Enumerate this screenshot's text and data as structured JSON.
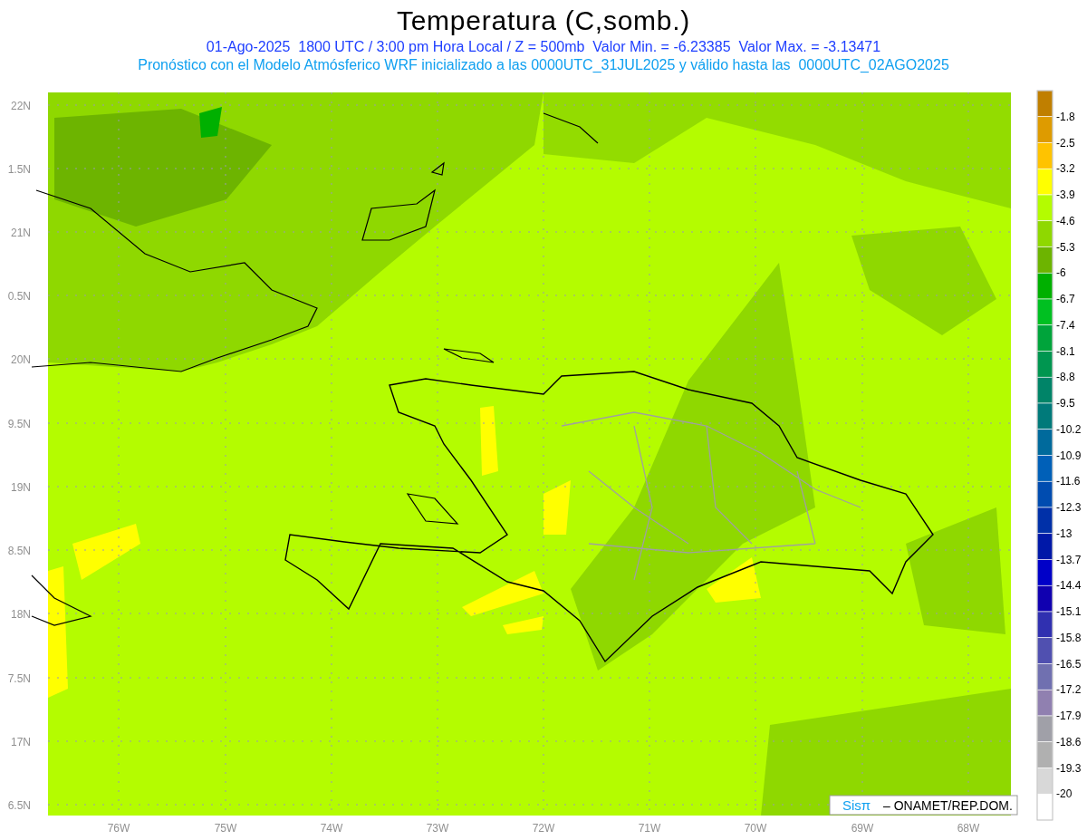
{
  "title": "Temperatura (C,somb.)",
  "subtitle_lines": [
    {
      "kind": "valid",
      "text": "01-Ago-2025  1800 UTC / 3:00 pm Hora Local / Z = 500mb  Valor Min. = -6.23385  Valor Max. = -3.13471"
    },
    {
      "kind": "model",
      "text": "Pronóstico con el Modelo Atmósferico WRF inicializado a las 0000UTC_31JUL2025 y válido hasta las  0000UTC_02AGO2025"
    }
  ],
  "map": {
    "y_axis_labels": [
      "22N",
      "1.5N",
      "21N",
      "0.5N",
      "20N",
      "9.5N",
      "19N",
      "8.5N",
      "18N",
      "7.5N",
      "17N",
      "6.5N"
    ],
    "x_axis_labels": [
      "76W",
      "75W",
      "74W",
      "73W",
      "72W",
      "71W",
      "70W",
      "69W",
      "68W"
    ]
  },
  "credit": {
    "logo": "Sisπ",
    "text": "– ONAMET/REP.DOM."
  },
  "colorbar": {
    "bins": [
      {
        "color": "#c07f00"
      },
      {
        "color": "#de9b00"
      },
      {
        "color": "#ffc300"
      },
      {
        "color": "#ffff00"
      },
      {
        "color": "#b4fc00"
      },
      {
        "color": "#8fd800"
      },
      {
        "color": "#6db400"
      },
      {
        "color": "#00b000"
      },
      {
        "color": "#00c021"
      },
      {
        "color": "#00a43b"
      },
      {
        "color": "#009650"
      },
      {
        "color": "#008468"
      },
      {
        "color": "#007a7a"
      },
      {
        "color": "#006a9c"
      },
      {
        "color": "#0060b8"
      },
      {
        "color": "#004cb0"
      },
      {
        "color": "#0030a8"
      },
      {
        "color": "#0018a8"
      },
      {
        "color": "#0000c8"
      },
      {
        "color": "#1000b0"
      },
      {
        "color": "#3030b0"
      },
      {
        "color": "#5050b0"
      },
      {
        "color": "#7070b0"
      },
      {
        "color": "#9080b0"
      },
      {
        "color": "#a0a0a8"
      },
      {
        "color": "#b0b0b0"
      },
      {
        "color": "#d8d8d8"
      },
      {
        "color": "#ffffff"
      }
    ],
    "labels": [
      "-1.8",
      "-2.5",
      "-3.2",
      "-3.9",
      "-4.6",
      "-5.3",
      "-6",
      "-6.7",
      "-7.4",
      "-8.1",
      "-8.8",
      "-9.5",
      "-10.2",
      "-10.9",
      "-11.6",
      "-12.3",
      "-13",
      "-13.7",
      "-14.4",
      "-15.1",
      "-15.8",
      "-16.5",
      "-17.2",
      "-17.9",
      "-18.6",
      "-19.3",
      "-20"
    ]
  }
}
